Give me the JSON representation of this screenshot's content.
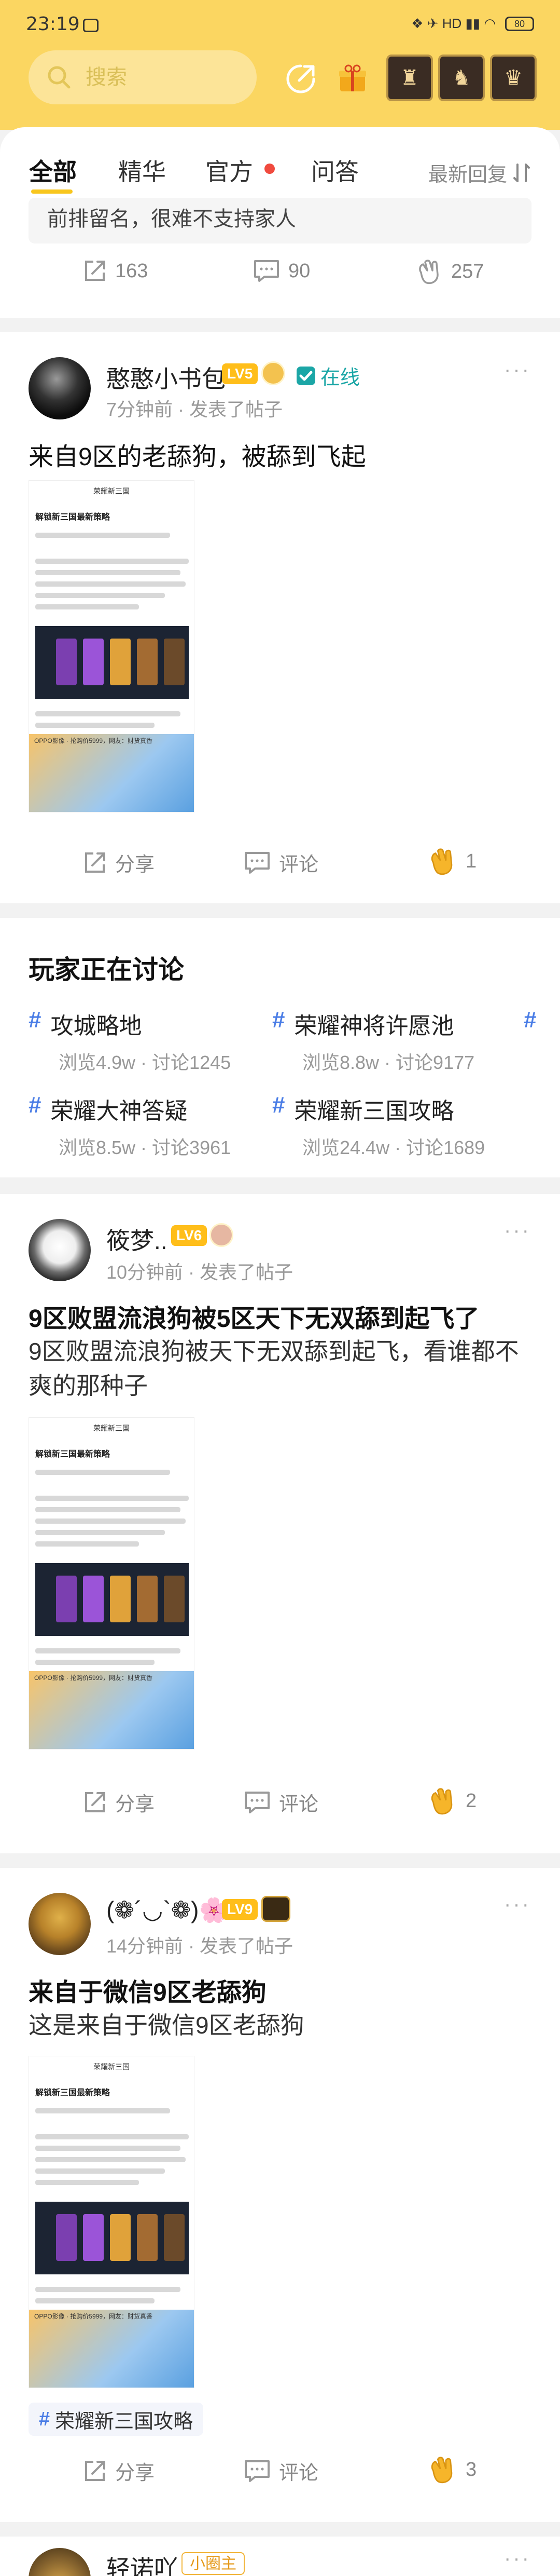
{
  "status_bar": {
    "time": "23:19",
    "icons_text": "❖ ✈ HD ▮▮ ◠",
    "battery": "80"
  },
  "header": {
    "search_placeholder": "搜索",
    "share_icon": "share-icon",
    "gift_icon": "gift-icon",
    "roles": [
      "role-avatar-1",
      "role-avatar-2",
      "role-avatar-3"
    ]
  },
  "tabs": {
    "items": [
      "全部",
      "精华",
      "官方",
      "问答"
    ],
    "active": "全部",
    "sort_label": "最新回复"
  },
  "post0": {
    "body_tail": "前排留名，很难不支持家人",
    "share_count": "163",
    "comment_count": "90",
    "like_count": "257"
  },
  "post1": {
    "username": "憨憨小书包",
    "level": "LV5",
    "online": "在线",
    "meta": "7分钟前 · 发表了帖子",
    "title": "来自9区的老舔狗，被舔到飞起",
    "share_label": "分享",
    "comment_label": "评论",
    "like_count": "1"
  },
  "thumbnail": {
    "top_label": "荣耀新三国",
    "heading": "解锁新三国最新策略",
    "footer_text": "OPPO影像 · 抢购价5999，网友：财货真香"
  },
  "discussion": {
    "title": "玩家正在讨论",
    "topics": [
      {
        "name": "攻城略地",
        "views": "浏览4.9w",
        "comments": "讨论1245"
      },
      {
        "name": "荣耀神将许愿池",
        "views": "浏览8.8w",
        "comments": "讨论9177"
      },
      {
        "name": "荣耀大神答疑",
        "views": "浏览8.5w",
        "comments": "讨论3961"
      },
      {
        "name": "荣耀新三国攻略",
        "views": "浏览24.4w",
        "comments": "讨论1689"
      }
    ]
  },
  "post2": {
    "username": "筱梦..",
    "level": "LV6",
    "meta": "10分钟前 · 发表了帖子",
    "title": "9区败盟流浪狗被5区天下无双舔到起飞了",
    "body": "9区败盟流浪狗被天下无双舔到起飞，看谁都不爽的那种子",
    "share_label": "分享",
    "comment_label": "评论",
    "like_count": "2"
  },
  "post3": {
    "username": "(❁´◡`❁)🌸",
    "level": "LV9",
    "meta": "14分钟前 · 发表了帖子",
    "title": "来自于微信9区老舔狗",
    "body": "这是来自于微信9区老舔狗",
    "topic": "荣耀新三国攻略",
    "share_label": "分享",
    "comment_label": "评论",
    "like_count": "3"
  },
  "post4": {
    "username": "轻诺吖",
    "badge": "小圈主"
  },
  "colors": {
    "header_yellow": "#fbd661",
    "accent_yellow": "#f8c61d",
    "hash_blue": "#4a7de6",
    "online_teal": "#1ba6a6",
    "clap_yellow": "#f6b52a"
  }
}
